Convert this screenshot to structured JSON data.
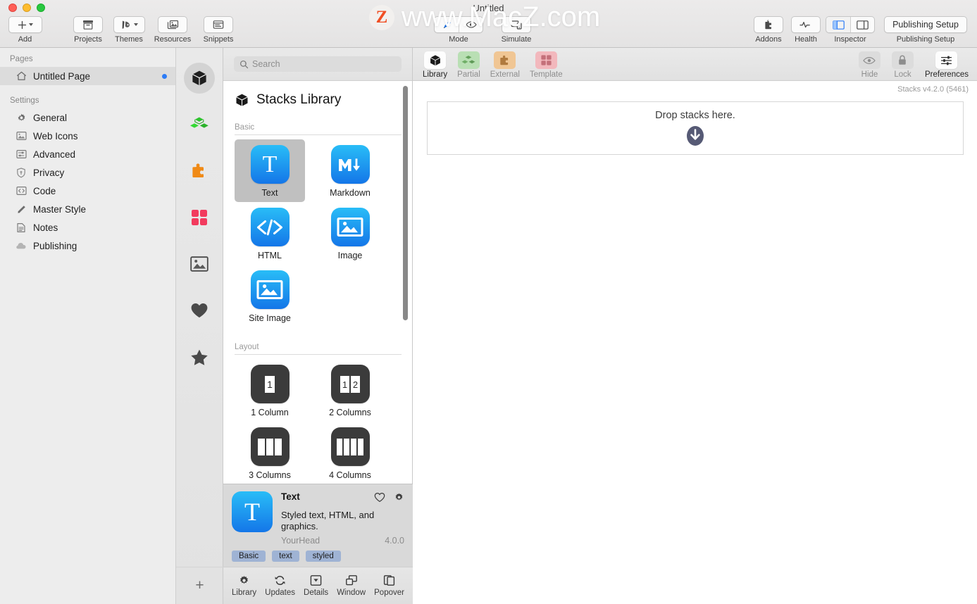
{
  "window": {
    "title": "Untitled",
    "traffic_lights": [
      "close-red",
      "minimize-yellow",
      "maximize-green"
    ]
  },
  "watermark": {
    "logo_letter": "Z",
    "text": "www.MacZ.com"
  },
  "toolbar": {
    "left": [
      {
        "label": "Add",
        "icon": "plus-icon",
        "has_caret": true
      },
      {
        "label": "Projects",
        "icon": "archive-box-icon",
        "has_caret": false
      },
      {
        "label": "Themes",
        "icon": "paintbrush-icon",
        "has_caret": true
      },
      {
        "label": "Resources",
        "icon": "photos-stack-icon",
        "has_caret": false
      },
      {
        "label": "Snippets",
        "icon": "snippet-window-icon",
        "has_caret": false
      }
    ],
    "center": [
      {
        "label": "Mode",
        "icon": "pen-eye-segment-icon"
      },
      {
        "label": "Simulate",
        "icon": "simulate-devices-icon"
      }
    ],
    "right": [
      {
        "label": "Addons",
        "icon": "addons-puzzle-icon"
      },
      {
        "label": "Health",
        "icon": "heartbeat-icon"
      },
      {
        "label": "Inspector",
        "icon": "inspector-panels-icon"
      }
    ],
    "publishing_setup": {
      "button_label": "Publishing Setup",
      "caption": "Publishing Setup"
    }
  },
  "sidebar": {
    "sections": [
      {
        "title": "Pages",
        "items": [
          {
            "label": "Untitled Page",
            "icon": "home-icon",
            "selected": true,
            "dot": true
          }
        ]
      },
      {
        "title": "Settings",
        "items": [
          {
            "label": "General",
            "icon": "gear-icon",
            "selected": false,
            "dot": false
          },
          {
            "label": "Web Icons",
            "icon": "image-icon",
            "selected": false,
            "dot": false
          },
          {
            "label": "Advanced",
            "icon": "sliders-icon",
            "selected": false,
            "dot": false
          },
          {
            "label": "Privacy",
            "icon": "shield-icon",
            "selected": false,
            "dot": false
          },
          {
            "label": "Code",
            "icon": "code-brackets-icon",
            "selected": false,
            "dot": false
          },
          {
            "label": "Master Style",
            "icon": "pen-nib-icon",
            "selected": false,
            "dot": false
          },
          {
            "label": "Notes",
            "icon": "notes-page-icon",
            "selected": false,
            "dot": false
          },
          {
            "label": "Publishing",
            "icon": "cloud-icon",
            "selected": false,
            "dot": false
          }
        ]
      }
    ],
    "add_button": "+"
  },
  "icon_strip": {
    "items": [
      {
        "icon": "cube-icon",
        "selected": true,
        "color": "#2b2b2b"
      },
      {
        "icon": "green-stacks-icon",
        "selected": false,
        "color": "#2ec42e"
      },
      {
        "icon": "orange-puzzle-icon",
        "selected": false,
        "color": "#f08a16"
      },
      {
        "icon": "pink-grid-icon",
        "selected": false,
        "color": "#f23b5e"
      },
      {
        "icon": "image-frame-icon",
        "selected": false,
        "color": "#4a4a4a"
      },
      {
        "icon": "heart-icon",
        "selected": false,
        "color": "#4a4a4a"
      },
      {
        "icon": "star-icon",
        "selected": false,
        "color": "#4a4a4a"
      }
    ],
    "add_button": "+"
  },
  "library": {
    "search": {
      "value": "",
      "placeholder": "Search",
      "icon": "search-magnifier-icon"
    },
    "title": "Stacks Library",
    "title_icon": "cube-icon",
    "groups": [
      {
        "label": "Basic",
        "tiles": [
          {
            "label": "Text",
            "icon": "letter-T-icon",
            "style": "blue",
            "selected": true
          },
          {
            "label": "Markdown",
            "icon": "markdown-M-arrow-icon",
            "style": "blue",
            "selected": false
          },
          {
            "label": "HTML",
            "icon": "code-slash-icon",
            "style": "blue",
            "selected": false
          },
          {
            "label": "Image",
            "icon": "picture-frame-icon",
            "style": "blue",
            "selected": false
          },
          {
            "label": "Site Image",
            "icon": "picture-frame-icon",
            "style": "blue",
            "selected": false
          }
        ]
      },
      {
        "label": "Layout",
        "tiles": [
          {
            "label": "1 Column",
            "icon": "one-column-icon",
            "style": "dark",
            "selected": false
          },
          {
            "label": "2 Columns",
            "icon": "two-columns-icon",
            "style": "dark",
            "selected": false
          },
          {
            "label": "3 Columns",
            "icon": "three-columns-icon",
            "style": "dark",
            "selected": false
          },
          {
            "label": "4 Columns",
            "icon": "four-columns-icon",
            "style": "dark",
            "selected": false
          }
        ]
      }
    ],
    "detail": {
      "name": "Text",
      "description": "Styled text, HTML, and graphics.",
      "vendor": "YourHead",
      "version": "4.0.0",
      "tags": [
        "Basic",
        "text",
        "styled"
      ],
      "favorite_icon": "heart-outline-icon",
      "settings_icon": "gear-icon"
    },
    "tabs": [
      {
        "label": "Library",
        "icon": "gear-icon"
      },
      {
        "label": "Updates",
        "icon": "refresh-icon"
      },
      {
        "label": "Details",
        "icon": "details-box-icon"
      },
      {
        "label": "Window",
        "icon": "window-icon"
      },
      {
        "label": "Popover",
        "icon": "popover-icon"
      }
    ]
  },
  "main": {
    "toolbar_left": [
      {
        "label": "Library",
        "icon": "cube-icon",
        "style": "white",
        "enabled": true
      },
      {
        "label": "Partial",
        "icon": "green-stacks-icon",
        "style": "green",
        "enabled": false
      },
      {
        "label": "External",
        "icon": "orange-puzzle-icon",
        "style": "orange",
        "enabled": false
      },
      {
        "label": "Template",
        "icon": "pink-grid-icon",
        "style": "pink",
        "enabled": false
      }
    ],
    "toolbar_right": [
      {
        "label": "Hide",
        "icon": "eye-icon",
        "style": "gray",
        "enabled": false
      },
      {
        "label": "Lock",
        "icon": "lock-icon",
        "style": "gray",
        "enabled": false
      },
      {
        "label": "Preferences",
        "icon": "sliders-icon",
        "style": "white",
        "enabled": true
      }
    ],
    "version_label": "Stacks v4.2.0 (5461)",
    "dropzone": {
      "text": "Drop stacks here.",
      "icon": "down-arrow-circle-icon"
    }
  },
  "colors": {
    "accent_blue": "#2d7cf6",
    "selection_gray": "#dcdcdc",
    "tile_blue_start": "#29bdf7",
    "tile_blue_end": "#1476e8",
    "tag_blue": "#9fb3d4",
    "dropzone_arrow": "#565a75"
  }
}
